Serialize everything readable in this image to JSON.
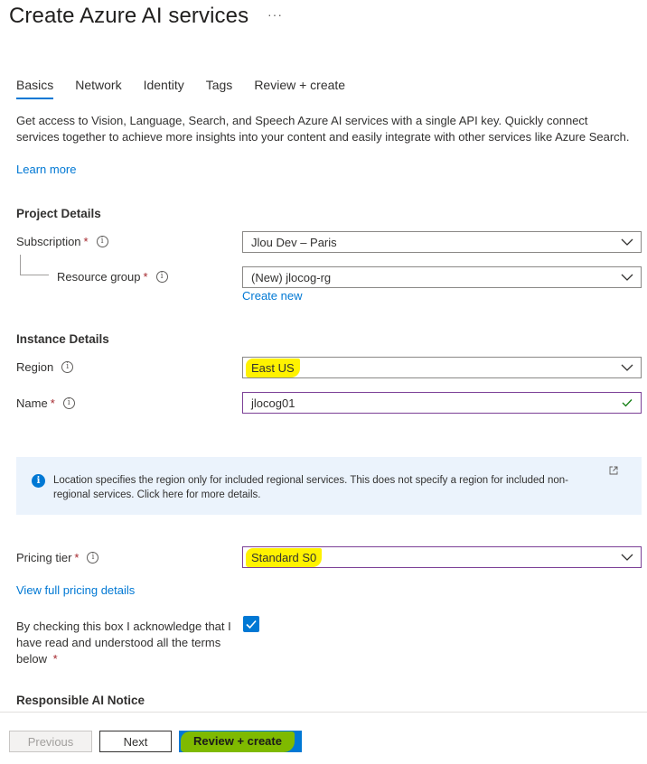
{
  "header": {
    "title": "Create Azure AI services",
    "more": "···"
  },
  "tabs": [
    "Basics",
    "Network",
    "Identity",
    "Tags",
    "Review + create"
  ],
  "intro": {
    "text": "Get access to Vision, Language, Search, and Speech Azure AI services with a single API key. Quickly connect services together to achieve more insights into your content and easily integrate with other services like Azure Search.",
    "learn_more": "Learn more"
  },
  "project": {
    "title": "Project Details",
    "subscription_label": "Subscription",
    "subscription_value": "Jlou Dev – Paris",
    "resource_group_label": "Resource group",
    "resource_group_value": "(New) jlocog-rg",
    "create_new": "Create new"
  },
  "instance": {
    "title": "Instance Details",
    "region_label": "Region",
    "region_value": "East US",
    "name_label": "Name",
    "name_value": "jlocog01"
  },
  "info_box": {
    "text": "Location specifies the region only for included regional services. This does not specify a region for included non-regional services. Click here for more details."
  },
  "pricing": {
    "label": "Pricing tier",
    "value": "Standard S0",
    "details_link": "View full pricing details"
  },
  "acknowledge": {
    "text": "By checking this box I acknowledge that I have read and understood all the terms below",
    "required": "*",
    "checked": true
  },
  "responsible_ai": {
    "title": "Responsible AI Notice"
  },
  "footer": {
    "previous": "Previous",
    "next": "Next",
    "review_create": "Review + create"
  },
  "required_marker": "*",
  "info_glyph": "i",
  "colors": {
    "accent": "#0078d4",
    "highlight_yellow": "#fff200",
    "highlight_green": "#7fba00",
    "required": "#a4262c",
    "valid_check": "#107c10"
  }
}
